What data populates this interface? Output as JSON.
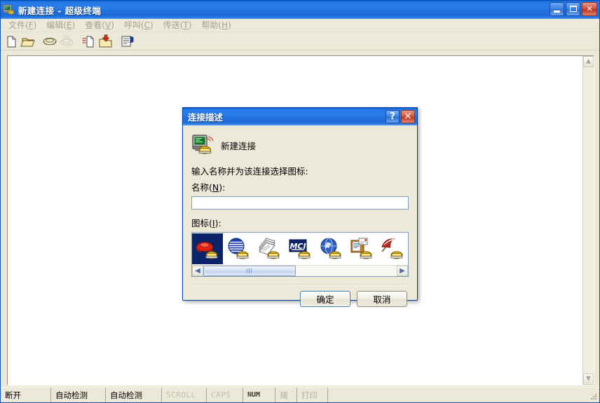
{
  "window": {
    "title": "新建连接 - 超级终端",
    "icon": "hyperterminal-icon",
    "buttons": {
      "minimize": "最小化",
      "maximize": "最大化",
      "close": "关闭"
    }
  },
  "menu": {
    "items": [
      {
        "label": "文件",
        "accel": "F"
      },
      {
        "label": "编辑",
        "accel": "E"
      },
      {
        "label": "查看",
        "accel": "V"
      },
      {
        "label": "呼叫",
        "accel": "C"
      },
      {
        "label": "传送",
        "accel": "T"
      },
      {
        "label": "帮助",
        "accel": "H"
      }
    ]
  },
  "toolbar": {
    "buttons": [
      {
        "name": "new-connection-icon",
        "enabled": true
      },
      {
        "name": "open-folder-icon",
        "enabled": true
      },
      {
        "name": "call-phone-icon",
        "enabled": true
      },
      {
        "name": "disconnect-phone-icon",
        "enabled": false
      },
      {
        "name": "send-file-icon",
        "enabled": true
      },
      {
        "name": "receive-file-icon",
        "enabled": true
      },
      {
        "name": "properties-icon",
        "enabled": true
      }
    ]
  },
  "terminal": {
    "content": "",
    "scrollbar": {
      "up": "向上",
      "down": "向下"
    }
  },
  "dialog": {
    "title": "连接描述",
    "title_buttons": {
      "help": "?",
      "close": "✕"
    },
    "heading": "新建连接",
    "heading_icon": "new-connection-icon",
    "instruction": "输入名称并为该连接选择图标:",
    "name_label": "名称",
    "name_accel": "N",
    "name_value": "",
    "name_placeholder": "",
    "icon_label": "图标",
    "icon_accel": "I",
    "icons": [
      {
        "name": "red-phone-icon",
        "selected": true
      },
      {
        "name": "globe-lines-icon",
        "selected": false
      },
      {
        "name": "papers-stack-icon",
        "selected": false
      },
      {
        "name": "mci-logo-icon",
        "selected": false
      },
      {
        "name": "blue-globe-icon",
        "selected": false
      },
      {
        "name": "documents-icon",
        "selected": false
      },
      {
        "name": "umbrella-icon",
        "selected": false
      }
    ],
    "scroll": {
      "left": "◀",
      "right": "▶"
    },
    "ok_label": "确定",
    "cancel_label": "取消"
  },
  "status_bar": {
    "cells": [
      {
        "text": "断开",
        "state": "active"
      },
      {
        "text": "自动检测",
        "state": "active"
      },
      {
        "text": "自动检测",
        "state": "active"
      },
      {
        "text": "SCROLL",
        "state": "mono-dim"
      },
      {
        "text": "CAPS",
        "state": "mono-dim"
      },
      {
        "text": "NUM",
        "state": "num-on"
      },
      {
        "text": "捕",
        "state": "dim"
      },
      {
        "text": "打印",
        "state": "dim"
      }
    ]
  },
  "colors": {
    "title_blue": "#2a7bea",
    "face": "#ece9d8",
    "close_red": "#be3a23",
    "selection_blue": "#0a246a",
    "terminal_bg": "#ffffff"
  }
}
